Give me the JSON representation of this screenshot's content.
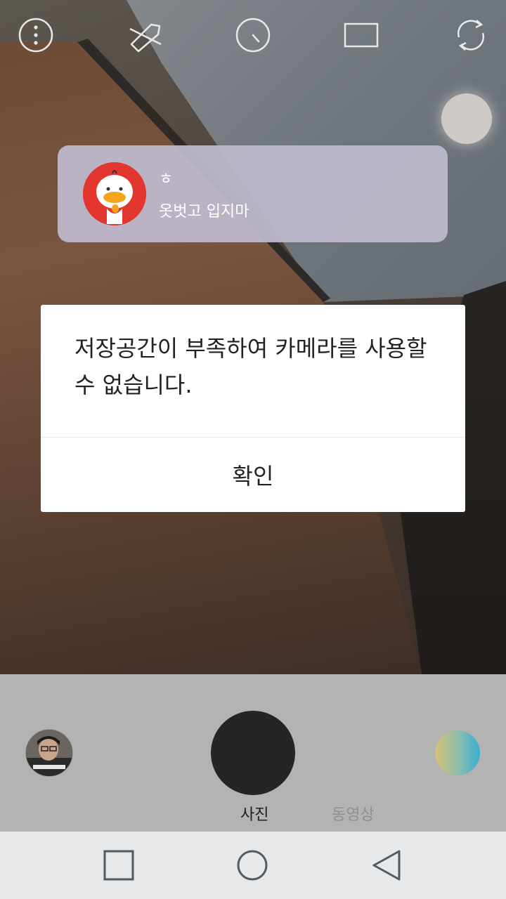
{
  "notification": {
    "title": "ㅎ",
    "message": "옷벗고 입지마"
  },
  "dialog": {
    "message": "저장공간이 부족하여 카메라를 사용할 수 없습니다.",
    "confirm_label": "확인"
  },
  "camera_modes": {
    "photo_label": "사진",
    "video_label": "동영상"
  },
  "icons": {
    "top": [
      "more-options-icon",
      "flash-off-icon",
      "timer-icon",
      "aspect-ratio-icon",
      "switch-camera-icon"
    ],
    "nav": [
      "recent-apps-icon",
      "home-icon",
      "back-icon"
    ]
  },
  "colors": {
    "dialog_bg": "#ffffff",
    "bottom_bar": "#b3b3b3",
    "shutter": "#252525",
    "notification_avatar": "#e2362e",
    "nav_bar": "#e6e8ea"
  }
}
